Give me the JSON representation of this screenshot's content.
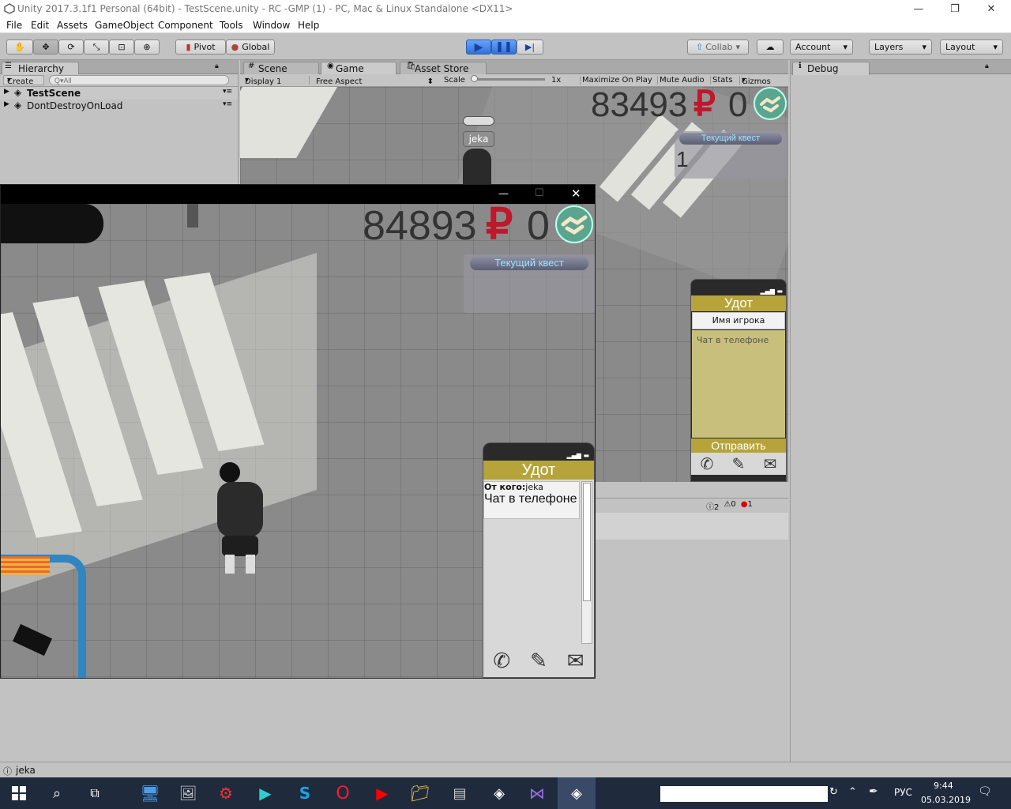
{
  "window": {
    "title": "Unity 2017.3.1f1 Personal (64bit) - TestScene.unity - RC -GMP (1) - PC, Mac & Linux Standalone <DX11>"
  },
  "menu": [
    "File",
    "Edit",
    "Assets",
    "GameObject",
    "Component",
    "Tools",
    "Window",
    "Help"
  ],
  "toolbar": {
    "pivot": "Pivot",
    "global": "Global",
    "collab": "Collab",
    "account": "Account",
    "layers": "Layers",
    "layout": "Layout"
  },
  "hierarchy": {
    "tab": "Hierarchy",
    "create": "Create",
    "search_placeholder": "Q▾All",
    "items": [
      "TestScene",
      "DontDestroyOnLoad"
    ]
  },
  "tabs": {
    "scene": "Scene",
    "game": "Game",
    "asset_store": "Asset Store",
    "debug": "Debug"
  },
  "game_bar": {
    "display": "Display 1",
    "aspect": "Free Aspect",
    "scale_label": "Scale",
    "scale_value": "1x",
    "maximize": "Maximize On Play",
    "mute": "Mute Audio",
    "stats": "Stats",
    "gizmos": "Gizmos"
  },
  "editor_game": {
    "money": "83493",
    "currency": "₽",
    "zero": "0",
    "quest_title": "Текущий квест",
    "quest_value": "1",
    "player_name": "jeka",
    "phone": {
      "title": "Удот",
      "name_field": "Имя игрока",
      "chat_placeholder": "Чат в телефоне",
      "send": "Отправить"
    }
  },
  "standalone": {
    "money": "84893",
    "currency": "₽",
    "zero": "0",
    "quest_title": "Текущий квест",
    "phone": {
      "title": "Удот",
      "from_label": "От кого:",
      "from_value": "jeka",
      "message": "Чат в телефоне"
    }
  },
  "console": {
    "info_count": "2",
    "warn_count": "0",
    "error_count": "1"
  },
  "status": {
    "text": "jeka"
  },
  "taskbar": {
    "lang": "РУС",
    "time": "9:44",
    "date": "05.03.2019"
  },
  "colors": {
    "unity_gray": "#c2c2c2",
    "phone_gold": "#b6a43a",
    "quest_text": "#9fe3ff",
    "play_blue": "#2f72d6",
    "taskbar": "#1f2a3d"
  }
}
